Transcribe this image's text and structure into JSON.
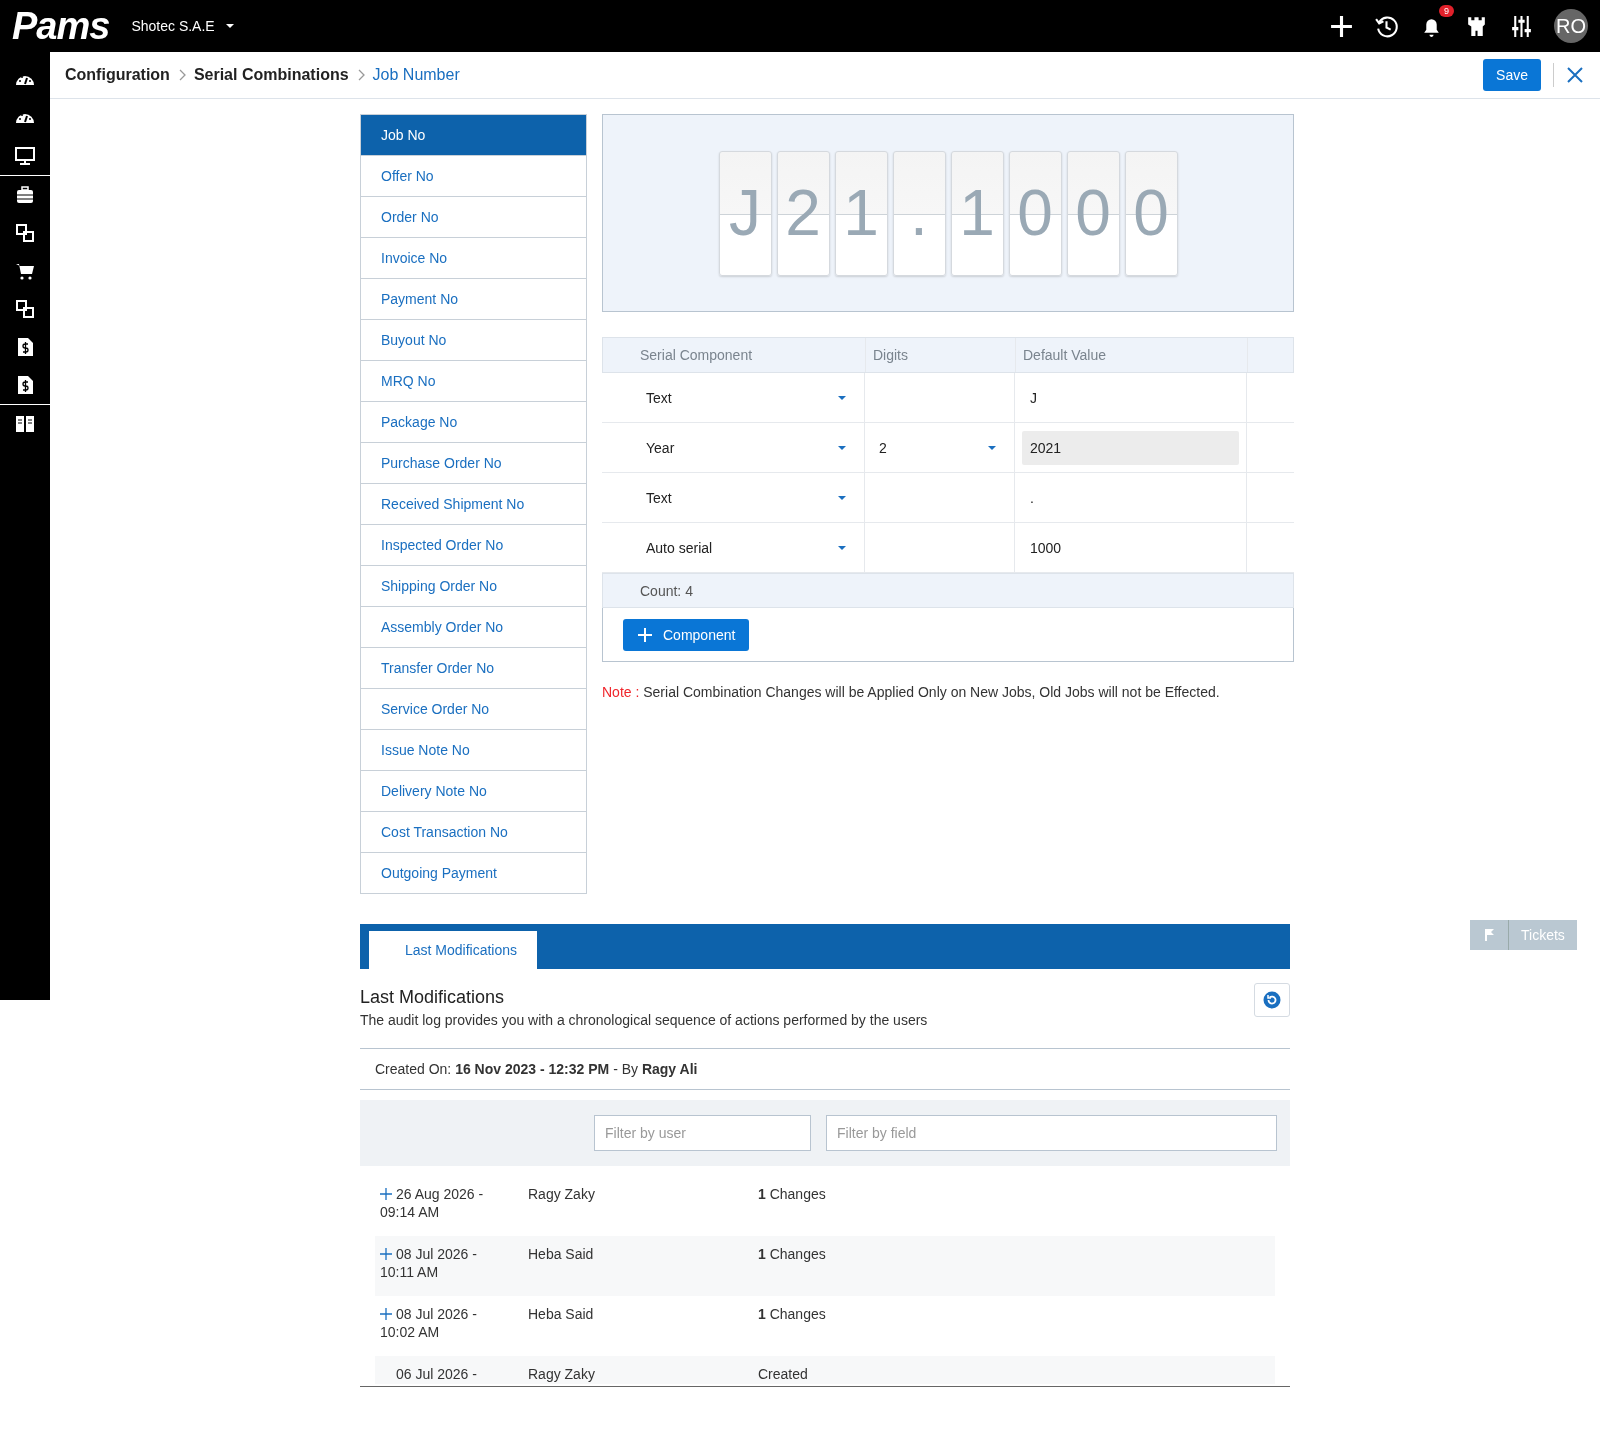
{
  "topbar": {
    "logo": "Pams",
    "company": "Shotec S.A.E",
    "notifications": "9",
    "avatar": "RO"
  },
  "breadcrumb": [
    {
      "label": "Configuration",
      "current": false
    },
    {
      "label": "Serial Combinations",
      "current": false
    },
    {
      "label": "Job Number",
      "current": true
    }
  ],
  "actions": {
    "save": "Save"
  },
  "serial_types": [
    {
      "label": "Job No",
      "selected": true
    },
    {
      "label": "Offer No",
      "selected": false
    },
    {
      "label": "Order No",
      "selected": false
    },
    {
      "label": "Invoice No",
      "selected": false
    },
    {
      "label": "Payment No",
      "selected": false
    },
    {
      "label": "Buyout No",
      "selected": false
    },
    {
      "label": "MRQ No",
      "selected": false
    },
    {
      "label": "Package No",
      "selected": false
    },
    {
      "label": "Purchase Order No",
      "selected": false
    },
    {
      "label": "Received Shipment No",
      "selected": false
    },
    {
      "label": "Inspected Order No",
      "selected": false
    },
    {
      "label": "Shipping Order No",
      "selected": false
    },
    {
      "label": "Assembly Order No",
      "selected": false
    },
    {
      "label": "Transfer Order No",
      "selected": false
    },
    {
      "label": "Service Order No",
      "selected": false
    },
    {
      "label": "Issue Note No",
      "selected": false
    },
    {
      "label": "Delivery Note No",
      "selected": false
    },
    {
      "label": "Cost Transaction No",
      "selected": false
    },
    {
      "label": "Outgoing Payment",
      "selected": false
    }
  ],
  "preview": [
    "J",
    "2",
    "1",
    ".",
    "1",
    "0",
    "0",
    "0"
  ],
  "components": {
    "columns": [
      "Serial Component",
      "Digits",
      "Default Value"
    ],
    "rows": [
      {
        "component": "Text",
        "digits": "",
        "default": "J",
        "readonly": false
      },
      {
        "component": "Year",
        "digits": "2",
        "default": "2021",
        "readonly": true
      },
      {
        "component": "Text",
        "digits": "",
        "default": ".",
        "readonly": false
      },
      {
        "component": "Auto serial",
        "digits": "",
        "default": "1000",
        "readonly": false
      }
    ],
    "count": "Count: 4",
    "add_button": "Component"
  },
  "note": {
    "label": "Note :",
    "text": "Serial Combination Changes will be Applied Only on New Jobs, Old Jobs will not be Effected."
  },
  "audit": {
    "tabs": [
      {
        "label": "Last Modifications",
        "selected": true
      }
    ],
    "title": "Last Modifications",
    "description": "The audit log provides you with a chronological sequence of actions performed by the users",
    "created": "Created On: **16 Nov 2023 - 12:32 PM** - By **Ragy Ali**",
    "filter_user": {
      "placeholder": "Filter by user"
    },
    "filter_field": {
      "placeholder": "Filter by field"
    },
    "entries": [
      {
        "date": "26 Aug 2026 -",
        "time": "09:14 AM",
        "user": "Ragy Zaky",
        "changes": "**1** Changes",
        "expandable": true
      },
      {
        "date": "08 Jul 2026 -",
        "time": "10:11 AM",
        "user": "Heba Said",
        "changes": "**1** Changes",
        "expandable": true
      },
      {
        "date": "08 Jul 2026 -",
        "time": "10:02 AM",
        "user": "Heba Said",
        "changes": "**1** Changes",
        "expandable": true
      },
      {
        "date": "06 Jul 2026 -",
        "user": "Ragy Zaky",
        "changes": "Created",
        "expandable": false
      }
    ]
  },
  "tickets": "Tickets"
}
